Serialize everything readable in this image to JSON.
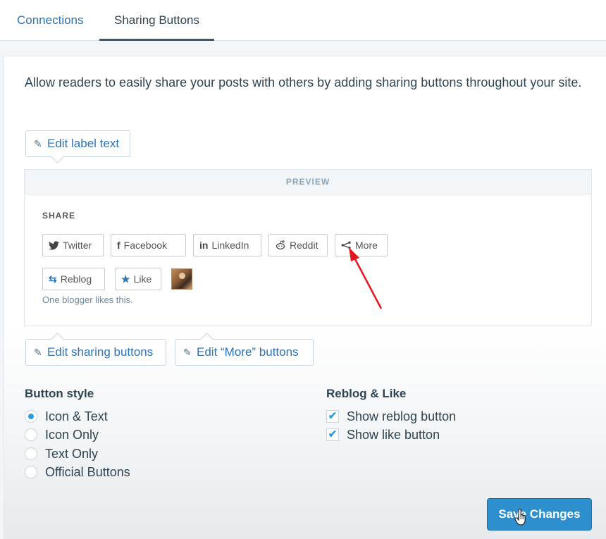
{
  "tabs": {
    "connections": "Connections",
    "sharing": "Sharing Buttons"
  },
  "intro": "Allow readers to easily share your posts with others by adding sharing buttons throughout your site.",
  "edit_label_text": "Edit label text",
  "preview": {
    "header": "PREVIEW",
    "share_title": "SHARE",
    "buttons": [
      {
        "label": "Twitter",
        "icon": "twitter-icon"
      },
      {
        "label": "Facebook",
        "icon": "facebook-icon"
      },
      {
        "label": "LinkedIn",
        "icon": "linkedin-icon"
      },
      {
        "label": "Reddit",
        "icon": "reddit-icon"
      },
      {
        "label": "More",
        "icon": "share-more-icon"
      }
    ],
    "reblog": "Reblog",
    "like": "Like",
    "likes_text": "One blogger likes this."
  },
  "edit_sharing_buttons": "Edit sharing buttons",
  "edit_more_buttons": "Edit “More” buttons",
  "button_style": {
    "title": "Button style",
    "options": [
      "Icon & Text",
      "Icon Only",
      "Text Only",
      "Official Buttons"
    ],
    "selected": "Icon & Text"
  },
  "reblog_like": {
    "title": "Reblog & Like",
    "options": [
      {
        "label": "Show reblog button",
        "checked": true
      },
      {
        "label": "Show like button",
        "checked": true
      }
    ]
  },
  "save_button": "Save Changes",
  "colors": {
    "accent": "#2e8fce",
    "link": "#2e74b5",
    "arrow": "#e8141c"
  }
}
